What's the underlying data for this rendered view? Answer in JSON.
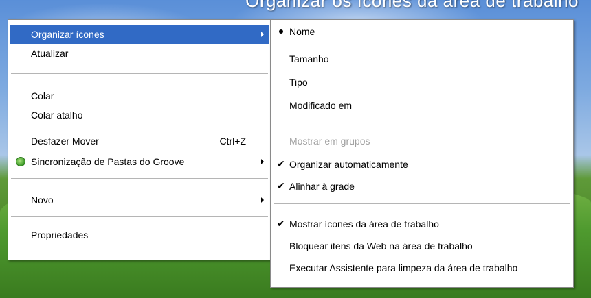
{
  "caption": "Organizar os ícones da área de trabalho",
  "main_menu": {
    "items": [
      {
        "label": "Organizar ícones"
      },
      {
        "label": "Atualizar"
      },
      {
        "label": "Colar"
      },
      {
        "label": "Colar atalho"
      },
      {
        "label": "Desfazer Mover",
        "shortcut": "Ctrl+Z"
      },
      {
        "label": "Sincronização de Pastas do Groove"
      },
      {
        "label": "Novo"
      },
      {
        "label": "Propriedades"
      }
    ]
  },
  "sub_menu": {
    "items": [
      {
        "label": "Nome",
        "marker": "bullet"
      },
      {
        "label": "Tamanho"
      },
      {
        "label": "Tipo"
      },
      {
        "label": "Modificado em"
      },
      {
        "label": "Mostrar em grupos",
        "state": "disabled"
      },
      {
        "label": "Organizar automaticamente",
        "marker": "check"
      },
      {
        "label": "Alinhar à grade",
        "marker": "check"
      },
      {
        "label": "Mostrar ícones da área de trabalho",
        "marker": "check"
      },
      {
        "label": "Bloquear itens da Web na área de trabalho"
      },
      {
        "label": "Executar Assistente para limpeza da área de trabalho"
      }
    ]
  },
  "colors": {
    "highlight": "#316ac5",
    "disabled_text": "#a0a0a0",
    "menu_background": "#ffffff"
  }
}
